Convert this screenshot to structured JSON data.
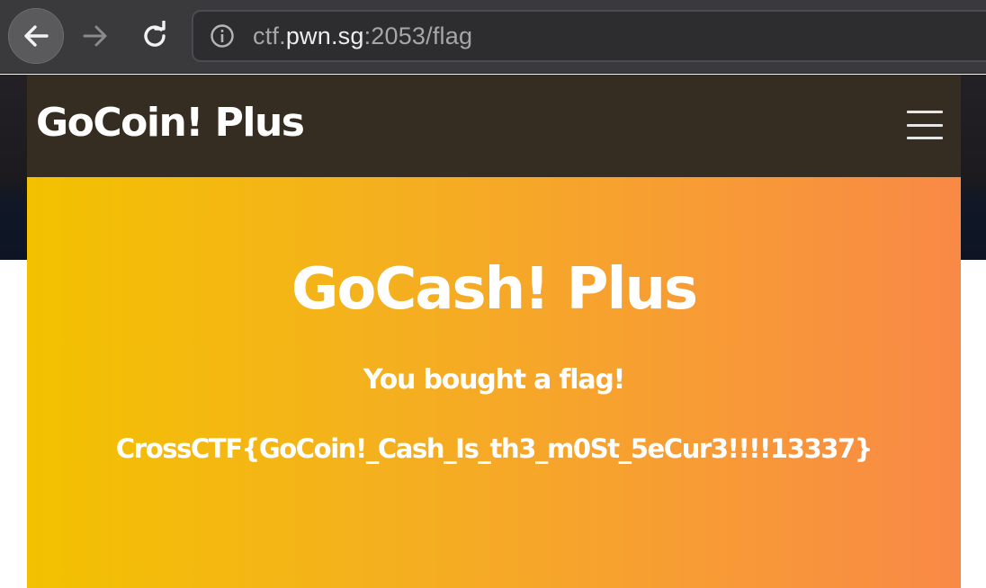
{
  "browser": {
    "url_prefix": "ctf.",
    "url_host": "pwn.sg",
    "url_suffix": ":2053/flag",
    "icons": {
      "back": "arrow-left-icon",
      "forward": "arrow-right-icon",
      "reload": "reload-icon",
      "info": "info-icon"
    }
  },
  "header": {
    "brand": "GoCoin! Plus",
    "menu_icon": "hamburger-menu-icon"
  },
  "hero": {
    "title": "GoCash! Plus",
    "subtitle": "You bought a flag!",
    "flag": "CrossCTF{GoCoin!_Cash_Is_th3_m0St_5eCur3!!!!13337}"
  },
  "colors": {
    "hero_gradient_start": "#f3c100",
    "hero_gradient_end": "#f98947",
    "header_bg": "#352c22",
    "browser_bg": "#3a3a3c"
  }
}
